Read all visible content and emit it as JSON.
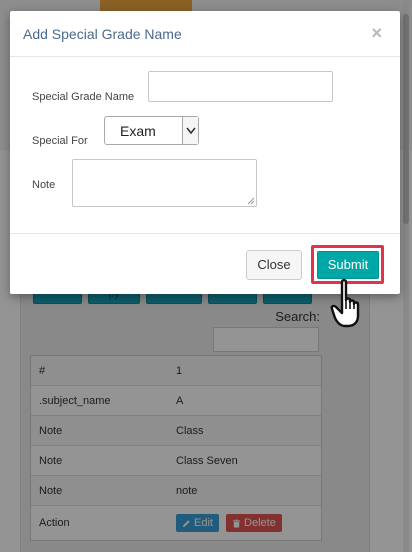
{
  "background": {
    "buttons": [
      "",
      "py",
      "",
      "",
      ""
    ],
    "search_label": "Search:",
    "table": {
      "rows": [
        {
          "key": "#",
          "value": "1"
        },
        {
          "key": ".subject_name",
          "value": "A"
        },
        {
          "key": "Note",
          "value": "Class"
        },
        {
          "key": "Note",
          "value": "Class Seven"
        },
        {
          "key": "Note",
          "value": "note"
        }
      ],
      "action_key": "Action",
      "edit_label": "Edit",
      "delete_label": "Delete"
    }
  },
  "modal": {
    "title": "Add Special Grade Name",
    "close_glyph": "×",
    "fields": {
      "name_label": "Special Grade Name",
      "name_value": "",
      "for_label": "Special For",
      "for_selected": "Exam",
      "note_label": "Note",
      "note_value": ""
    },
    "footer": {
      "close_label": "Close",
      "submit_label": "Submit"
    }
  },
  "colors": {
    "accent": "#00a7a7",
    "highlight": "#e0334d",
    "title": "#4a6a8f"
  },
  "icons": {
    "close": "close-icon",
    "dropdown": "chevron-down-icon",
    "edit": "pencil-icon",
    "delete": "trash-icon",
    "pointer": "pointing-hand-icon"
  }
}
